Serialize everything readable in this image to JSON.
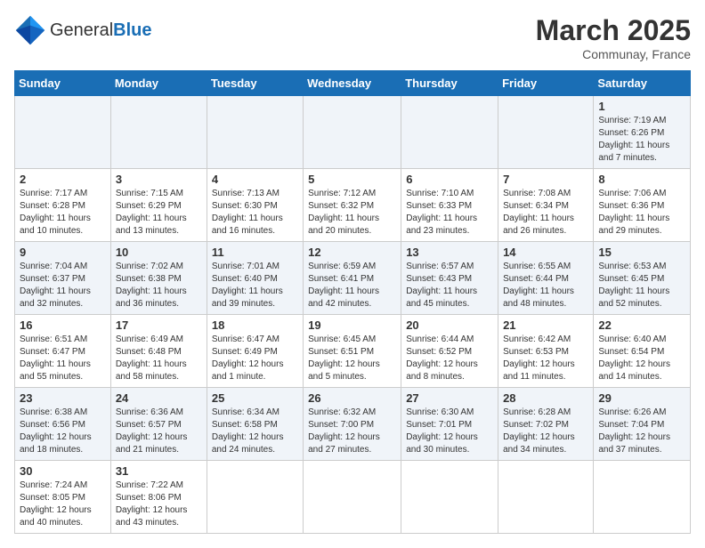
{
  "header": {
    "logo_general": "General",
    "logo_blue": "Blue",
    "month_title": "March 2025",
    "location": "Communay, France"
  },
  "days_of_week": [
    "Sunday",
    "Monday",
    "Tuesday",
    "Wednesday",
    "Thursday",
    "Friday",
    "Saturday"
  ],
  "weeks": [
    [
      {
        "day": "",
        "info": ""
      },
      {
        "day": "",
        "info": ""
      },
      {
        "day": "",
        "info": ""
      },
      {
        "day": "",
        "info": ""
      },
      {
        "day": "",
        "info": ""
      },
      {
        "day": "",
        "info": ""
      },
      {
        "day": "1",
        "info": "Sunrise: 7:19 AM\nSunset: 6:26 PM\nDaylight: 11 hours and 7 minutes."
      }
    ],
    [
      {
        "day": "2",
        "info": "Sunrise: 7:17 AM\nSunset: 6:28 PM\nDaylight: 11 hours and 10 minutes."
      },
      {
        "day": "3",
        "info": "Sunrise: 7:15 AM\nSunset: 6:29 PM\nDaylight: 11 hours and 13 minutes."
      },
      {
        "day": "4",
        "info": "Sunrise: 7:13 AM\nSunset: 6:30 PM\nDaylight: 11 hours and 16 minutes."
      },
      {
        "day": "5",
        "info": "Sunrise: 7:12 AM\nSunset: 6:32 PM\nDaylight: 11 hours and 20 minutes."
      },
      {
        "day": "6",
        "info": "Sunrise: 7:10 AM\nSunset: 6:33 PM\nDaylight: 11 hours and 23 minutes."
      },
      {
        "day": "7",
        "info": "Sunrise: 7:08 AM\nSunset: 6:34 PM\nDaylight: 11 hours and 26 minutes."
      },
      {
        "day": "8",
        "info": "Sunrise: 7:06 AM\nSunset: 6:36 PM\nDaylight: 11 hours and 29 minutes."
      }
    ],
    [
      {
        "day": "9",
        "info": "Sunrise: 7:04 AM\nSunset: 6:37 PM\nDaylight: 11 hours and 32 minutes."
      },
      {
        "day": "10",
        "info": "Sunrise: 7:02 AM\nSunset: 6:38 PM\nDaylight: 11 hours and 36 minutes."
      },
      {
        "day": "11",
        "info": "Sunrise: 7:01 AM\nSunset: 6:40 PM\nDaylight: 11 hours and 39 minutes."
      },
      {
        "day": "12",
        "info": "Sunrise: 6:59 AM\nSunset: 6:41 PM\nDaylight: 11 hours and 42 minutes."
      },
      {
        "day": "13",
        "info": "Sunrise: 6:57 AM\nSunset: 6:43 PM\nDaylight: 11 hours and 45 minutes."
      },
      {
        "day": "14",
        "info": "Sunrise: 6:55 AM\nSunset: 6:44 PM\nDaylight: 11 hours and 48 minutes."
      },
      {
        "day": "15",
        "info": "Sunrise: 6:53 AM\nSunset: 6:45 PM\nDaylight: 11 hours and 52 minutes."
      }
    ],
    [
      {
        "day": "16",
        "info": "Sunrise: 6:51 AM\nSunset: 6:47 PM\nDaylight: 11 hours and 55 minutes."
      },
      {
        "day": "17",
        "info": "Sunrise: 6:49 AM\nSunset: 6:48 PM\nDaylight: 11 hours and 58 minutes."
      },
      {
        "day": "18",
        "info": "Sunrise: 6:47 AM\nSunset: 6:49 PM\nDaylight: 12 hours and 1 minute."
      },
      {
        "day": "19",
        "info": "Sunrise: 6:45 AM\nSunset: 6:51 PM\nDaylight: 12 hours and 5 minutes."
      },
      {
        "day": "20",
        "info": "Sunrise: 6:44 AM\nSunset: 6:52 PM\nDaylight: 12 hours and 8 minutes."
      },
      {
        "day": "21",
        "info": "Sunrise: 6:42 AM\nSunset: 6:53 PM\nDaylight: 12 hours and 11 minutes."
      },
      {
        "day": "22",
        "info": "Sunrise: 6:40 AM\nSunset: 6:54 PM\nDaylight: 12 hours and 14 minutes."
      }
    ],
    [
      {
        "day": "23",
        "info": "Sunrise: 6:38 AM\nSunset: 6:56 PM\nDaylight: 12 hours and 18 minutes."
      },
      {
        "day": "24",
        "info": "Sunrise: 6:36 AM\nSunset: 6:57 PM\nDaylight: 12 hours and 21 minutes."
      },
      {
        "day": "25",
        "info": "Sunrise: 6:34 AM\nSunset: 6:58 PM\nDaylight: 12 hours and 24 minutes."
      },
      {
        "day": "26",
        "info": "Sunrise: 6:32 AM\nSunset: 7:00 PM\nDaylight: 12 hours and 27 minutes."
      },
      {
        "day": "27",
        "info": "Sunrise: 6:30 AM\nSunset: 7:01 PM\nDaylight: 12 hours and 30 minutes."
      },
      {
        "day": "28",
        "info": "Sunrise: 6:28 AM\nSunset: 7:02 PM\nDaylight: 12 hours and 34 minutes."
      },
      {
        "day": "29",
        "info": "Sunrise: 6:26 AM\nSunset: 7:04 PM\nDaylight: 12 hours and 37 minutes."
      }
    ],
    [
      {
        "day": "30",
        "info": "Sunrise: 7:24 AM\nSunset: 8:05 PM\nDaylight: 12 hours and 40 minutes."
      },
      {
        "day": "31",
        "info": "Sunrise: 7:22 AM\nSunset: 8:06 PM\nDaylight: 12 hours and 43 minutes."
      },
      {
        "day": "",
        "info": ""
      },
      {
        "day": "",
        "info": ""
      },
      {
        "day": "",
        "info": ""
      },
      {
        "day": "",
        "info": ""
      },
      {
        "day": "",
        "info": ""
      }
    ]
  ]
}
